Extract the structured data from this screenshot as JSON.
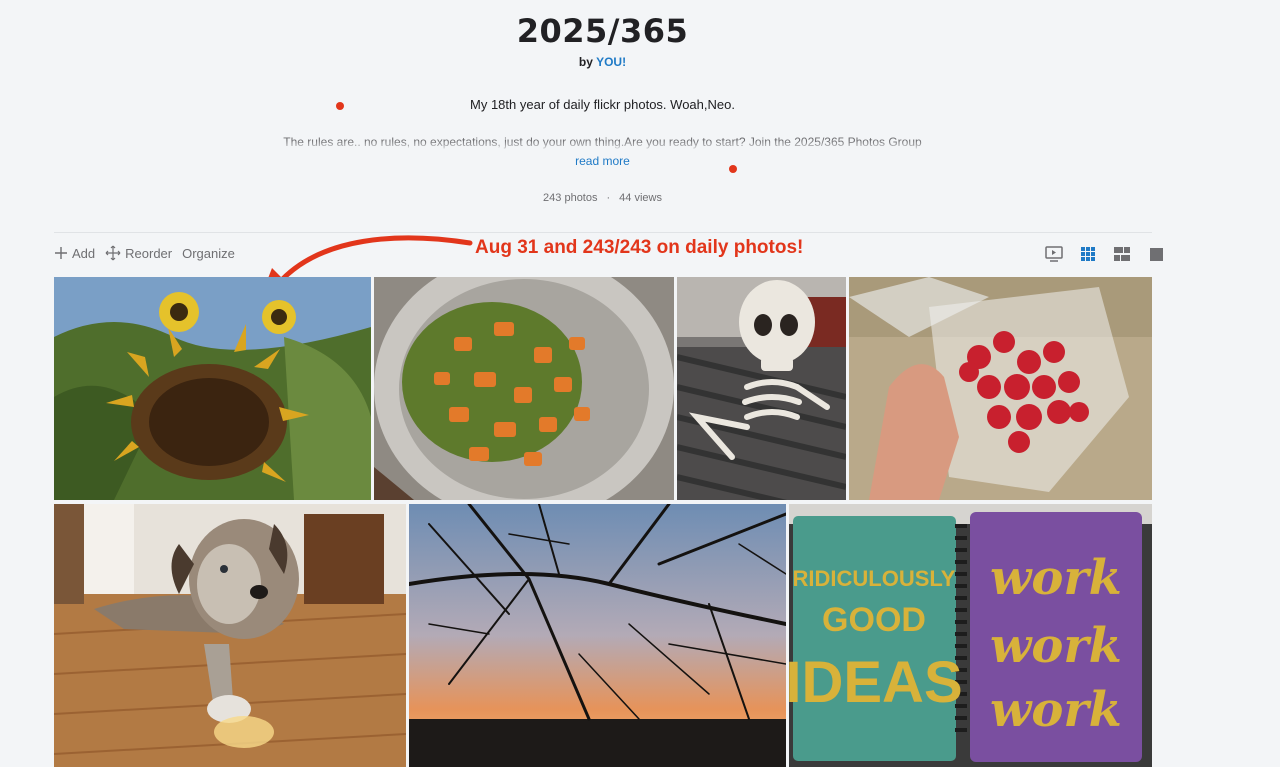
{
  "album": {
    "title": "2025/365",
    "by_prefix": "by",
    "owner": "YOU!",
    "description_line1": "My 18th year of daily flickr photos. Woah,Neo.",
    "description_line2": "The rules are.. no rules, no expectations, just do your own thing.Are you ready to start? Join the 2025/365 Photos Group",
    "read_more": "read more",
    "photo_count": "243 photos",
    "separator": "·",
    "view_count": "44 views"
  },
  "toolbar": {
    "add": "Add",
    "reorder": "Reorder",
    "organize": "Organize"
  },
  "annotation": {
    "text": "Aug 31 and 243/243 on daily photos!",
    "color": "#e2361b"
  },
  "view_modes": [
    {
      "icon": "slideshow-icon",
      "active": false
    },
    {
      "icon": "grid-small-icon",
      "active": true
    },
    {
      "icon": "grid-medium-icon",
      "active": false
    },
    {
      "icon": "grid-large-icon",
      "active": false
    }
  ],
  "photos": [
    {
      "subject": "sunflower"
    },
    {
      "subject": "peas-and-carrots-bowl"
    },
    {
      "subject": "skeleton"
    },
    {
      "subject": "raspberries"
    },
    {
      "subject": "dog"
    },
    {
      "subject": "sunset-branches"
    },
    {
      "subject": "notebooks"
    }
  ],
  "notebook_text": {
    "left_line1": "RIDICULOUSLY",
    "left_line2": "GOOD",
    "left_line3": "IDEAS",
    "right_word": "work"
  },
  "colors": {
    "link": "#1f7ac6",
    "accent": "#e2361b",
    "view_active": "#1f7ac6"
  }
}
